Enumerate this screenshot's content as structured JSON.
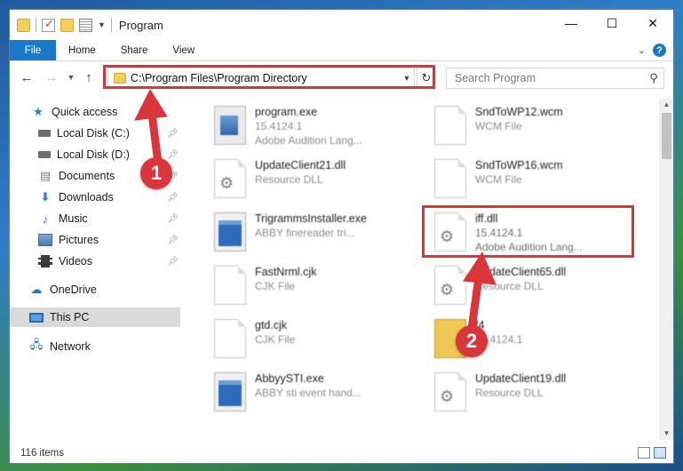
{
  "window": {
    "title": "Program",
    "controls": {
      "minimize": "—",
      "maximize": "☐",
      "close": "✕"
    }
  },
  "ribbon": {
    "tabs": [
      "File",
      "Home",
      "Share",
      "View"
    ],
    "expand_icon": "chevron-down",
    "help": "?"
  },
  "address": {
    "path": "C:\\Program Files\\Program Directory",
    "search_placeholder": "Search Program"
  },
  "sidebar": {
    "items": [
      {
        "label": "Quick access",
        "icon": "star-icon"
      },
      {
        "label": "Local Disk (C:)",
        "icon": "disk-icon",
        "pinned": true
      },
      {
        "label": "Local Disk (D:)",
        "icon": "disk-icon",
        "pinned": true
      },
      {
        "label": "Documents",
        "icon": "documents-icon",
        "pinned": true
      },
      {
        "label": "Downloads",
        "icon": "download-icon",
        "pinned": true
      },
      {
        "label": "Music",
        "icon": "music-icon",
        "pinned": true
      },
      {
        "label": "Pictures",
        "icon": "pictures-icon",
        "pinned": true
      },
      {
        "label": "Videos",
        "icon": "videos-icon",
        "pinned": true
      },
      {
        "label": "OneDrive",
        "icon": "cloud-icon"
      },
      {
        "label": "This PC",
        "icon": "computer-icon",
        "selected": true
      },
      {
        "label": "Network",
        "icon": "network-icon"
      }
    ]
  },
  "files": [
    {
      "name": "program.exe",
      "line2": "15.4124.1",
      "line3": "Adobe Audition Lang...",
      "icon": "exe-icon"
    },
    {
      "name": "SndToWP12.wcm",
      "line2": "WCM File",
      "line3": "",
      "icon": "document-icon"
    },
    {
      "name": "UpdateClient21.dll",
      "line2": "Resource DLL",
      "line3": "",
      "icon": "dll-gear-icon"
    },
    {
      "name": "SndToWP16.wcm",
      "line2": "WCM File",
      "line3": "",
      "icon": "document-icon"
    },
    {
      "name": "TrigrammsInstaller.exe",
      "line2": "ABBY finereader tri...",
      "line3": "",
      "icon": "window-exe-icon"
    },
    {
      "name": "iff.dll",
      "line2": "15.4124.1",
      "line3": "Adobe Audition Lang...",
      "icon": "dll-gear-icon"
    },
    {
      "name": "FastNrml.cjk",
      "line2": "CJK File",
      "line3": "",
      "icon": "document-icon"
    },
    {
      "name": "UpdateClient65.dll",
      "line2": "Resource DLL",
      "line3": "",
      "icon": "dll-gear-icon"
    },
    {
      "name": "gtd.cjk",
      "line2": "CJK File",
      "line3": "",
      "icon": "document-icon"
    },
    {
      "name": "f4",
      "line2": "15.4124.1",
      "line3": "",
      "icon": "folder-zip-icon"
    },
    {
      "name": "AbbyySTI.exe",
      "line2": "ABBY sti event hand...",
      "line3": "",
      "icon": "window-exe-icon"
    },
    {
      "name": "UpdateClient19.dll",
      "line2": "Resource DLL",
      "line3": "",
      "icon": "dll-gear-icon"
    }
  ],
  "status": {
    "item_count": "116 items"
  },
  "annotations": {
    "step1": "1",
    "step2": "2",
    "color": "#d9353a"
  }
}
